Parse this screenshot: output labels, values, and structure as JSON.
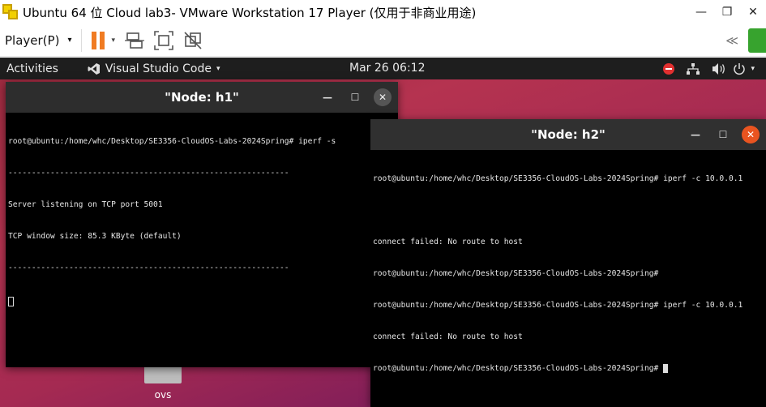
{
  "vmware": {
    "title": "Ubuntu 64 位 Cloud lab3- VMware Workstation 17 Player (仅用于非商业用途)",
    "window_controls": {
      "minimize": "—",
      "restore": "❐",
      "close": "✕"
    },
    "toolbar": {
      "player_menu": "Player(P)",
      "caret": "▾",
      "rewind": "≪"
    }
  },
  "ubuntu": {
    "topbar": {
      "activities": "Activities",
      "app_name": "Visual Studio Code",
      "app_caret": "▾",
      "clock": "Mar 26  06:12",
      "tray_power_caret": "▾"
    },
    "desktop_icon_label": "ovs",
    "terminals": [
      {
        "title": "\"Node: h1\"",
        "lines": [
          "root@ubuntu:/home/whc/Desktop/SE3356-CloudOS-Labs-2024Spring# iperf -s",
          "------------------------------------------------------------",
          "Server listening on TCP port 5001",
          "TCP window size: 85.3 KByte (default)",
          "------------------------------------------------------------"
        ]
      },
      {
        "title": "\"Node: h2\"",
        "lines": [
          "root@ubuntu:/home/whc/Desktop/SE3356-CloudOS-Labs-2024Spring# iperf -c 10.0.0.1",
          "",
          "connect failed: No route to host",
          "root@ubuntu:/home/whc/Desktop/SE3356-CloudOS-Labs-2024Spring#",
          "root@ubuntu:/home/whc/Desktop/SE3356-CloudOS-Labs-2024Spring# iperf -c 10.0.0.1",
          "connect failed: No route to host"
        ],
        "prompt": "root@ubuntu:/home/whc/Desktop/SE3356-CloudOS-Labs-2024Spring# "
      }
    ],
    "terminal_controls": {
      "minimize": "—",
      "maximize": "☐",
      "close": "✕"
    }
  },
  "colors": {
    "pause_accent": "#f07b22",
    "ubuntu_orange": "#e95420",
    "vmware_green": "#37a32e"
  }
}
